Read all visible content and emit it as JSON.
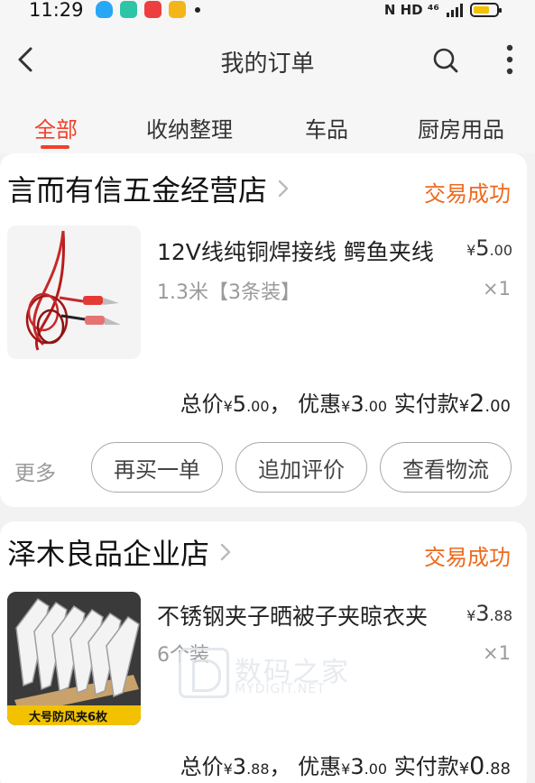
{
  "status_bar": {
    "time": "11:29",
    "right_text": "N HD ⁴⁶"
  },
  "nav": {
    "title": "我的订单"
  },
  "tabs": [
    "全部",
    "收纳整理",
    "车品",
    "厨房用品"
  ],
  "orders": [
    {
      "shop": "言而有信五金经营店",
      "status": "交易成功",
      "product": {
        "title": "12V线纯铜焊接线 鳄鱼夹线",
        "spec": "1.3米【3条装】",
        "currency": "¥",
        "price_int": "5",
        "price_dec": ".00",
        "qty": "×1"
      },
      "totals": {
        "total_label": "总价",
        "currency": "¥",
        "total_int": "5",
        "total_dec": ".00",
        "sep": "，",
        "discount_label": "优惠",
        "discount_int": "3",
        "discount_dec": ".00",
        "paid_label": "实付款",
        "paid_int": "2",
        "paid_dec": ".00"
      },
      "actions": {
        "more": "更多",
        "rebuy": "再买一单",
        "review": "追加评价",
        "logistics": "查看物流"
      }
    },
    {
      "shop": "泽木良品企业店",
      "status": "交易成功",
      "product": {
        "title": "不锈钢夹子晒被子夹晾衣夹",
        "spec": "6个装",
        "currency": "¥",
        "price_int": "3",
        "price_dec": ".88",
        "qty": "×1",
        "image_caption": "大号防风夹6枚"
      },
      "totals": {
        "total_label": "总价",
        "currency": "¥",
        "total_int": "3",
        "total_dec": ".88",
        "sep": "，",
        "discount_label": "优惠",
        "discount_int": "3",
        "discount_dec": ".00",
        "paid_label": "实付款",
        "paid_int": "0",
        "paid_dec": ".88"
      }
    }
  ],
  "watermark": {
    "cn": "数码之家",
    "en": "MYDIGIT.NET"
  },
  "colors": {
    "accent": "#f2402a",
    "status": "#ee6a1e",
    "background": "#f2f2f2"
  }
}
